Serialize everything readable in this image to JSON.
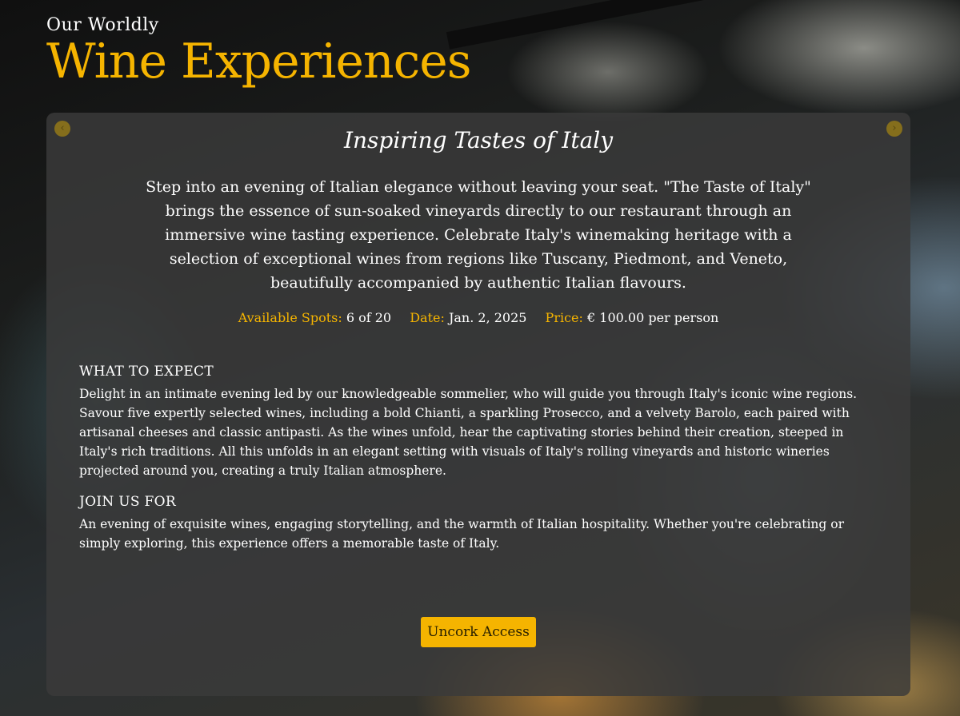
{
  "header": {
    "kicker": "Our Worldly",
    "title": "Wine Experiences"
  },
  "carousel": {
    "prev_icon": "chevron-left-icon",
    "next_icon": "chevron-right-icon",
    "prev_glyph": "‹",
    "next_glyph": "›"
  },
  "experience": {
    "title": "Inspiring Tastes of Italy",
    "intro": "Step into an evening of Italian elegance without leaving your seat. \"The Taste of Italy\" brings the essence of sun-soaked vineyards directly to our restaurant through an immersive wine tasting experience. Celebrate Italy's winemaking heritage with a selection of exceptional wines from regions like Tuscany, Piedmont, and Veneto, beautifully accompanied by authentic Italian flavours.",
    "meta": {
      "spots_label": "Available Spots:",
      "spots_value": "6 of 20",
      "date_label": "Date:",
      "date_value": "Jan. 2, 2025",
      "price_label": "Price:",
      "price_value": "€ 100.00 per person"
    },
    "sections": [
      {
        "heading": "WHAT TO EXPECT",
        "body": "Delight in an intimate evening led by our knowledgeable sommelier, who will guide you through Italy's iconic wine regions. Savour five expertly selected wines, including a bold Chianti, a sparkling Prosecco, and a velvety Barolo, each paired with artisanal cheeses and classic antipasti. As the wines unfold, hear the captivating stories behind their creation, steeped in Italy's rich traditions. All this unfolds in an elegant setting with visuals of Italy's rolling vineyards and historic wineries projected around you, creating a truly Italian atmosphere."
      },
      {
        "heading": "JOIN US FOR",
        "body": "An evening of exquisite wines, engaging storytelling, and the warmth of Italian hospitality. Whether you're celebrating or simply exploring, this experience offers a memorable taste of Italy."
      }
    ],
    "cta_label": "Uncork Access"
  },
  "colors": {
    "accent": "#f5b400",
    "card": "#3a3a3a",
    "text": "#ffffff"
  }
}
